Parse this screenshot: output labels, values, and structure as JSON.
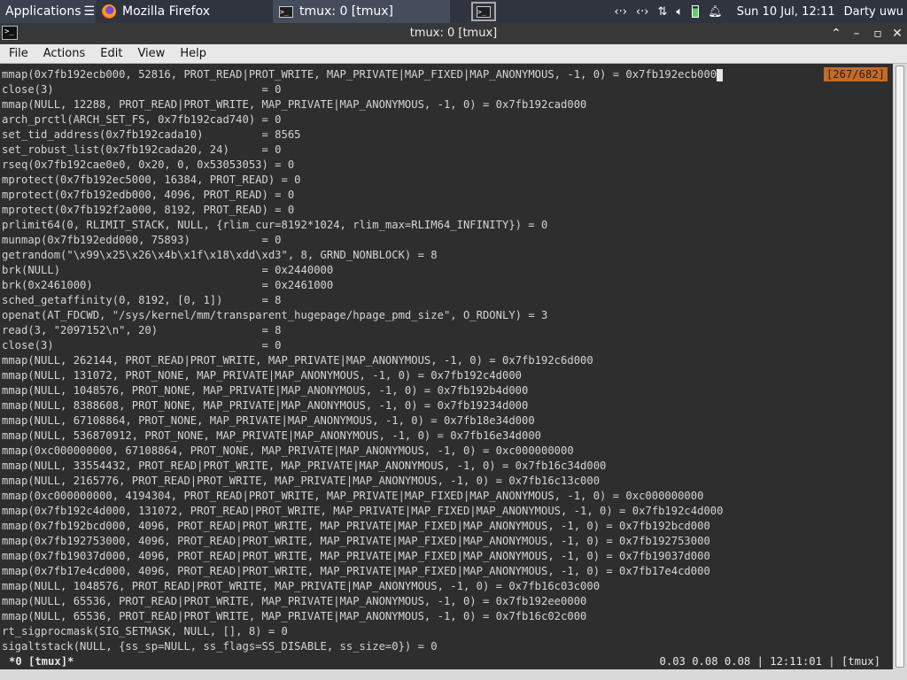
{
  "panel": {
    "app_menu": "Applications",
    "tasks": [
      {
        "label": "Mozilla Firefox",
        "icon": "firefox-icon"
      },
      {
        "label": "tmux: 0 [tmux]",
        "icon": "terminal-icon"
      }
    ],
    "clock": "Sun 10 Jul, 12:11",
    "user": "Darty uwu"
  },
  "window": {
    "title": "tmux: 0 [tmux]"
  },
  "menu": [
    "File",
    "Actions",
    "Edit",
    "View",
    "Help"
  ],
  "terminal": {
    "position_indicator": "[267/682]",
    "lines": [
      "mmap(0x7fb192ecb000, 52816, PROT_READ|PROT_WRITE, MAP_PRIVATE|MAP_FIXED|MAP_ANONYMOUS, -1, 0) = 0x7fb192ecb000",
      "close(3)                                = 0",
      "mmap(NULL, 12288, PROT_READ|PROT_WRITE, MAP_PRIVATE|MAP_ANONYMOUS, -1, 0) = 0x7fb192cad000",
      "arch_prctl(ARCH_SET_FS, 0x7fb192cad740) = 0",
      "set_tid_address(0x7fb192cada10)         = 8565",
      "set_robust_list(0x7fb192cada20, 24)     = 0",
      "rseq(0x7fb192cae0e0, 0x20, 0, 0x53053053) = 0",
      "mprotect(0x7fb192ec5000, 16384, PROT_READ) = 0",
      "mprotect(0x7fb192edb000, 4096, PROT_READ) = 0",
      "mprotect(0x7fb192f2a000, 8192, PROT_READ) = 0",
      "prlimit64(0, RLIMIT_STACK, NULL, {rlim_cur=8192*1024, rlim_max=RLIM64_INFINITY}) = 0",
      "munmap(0x7fb192edd000, 75893)           = 0",
      "getrandom(\"\\x99\\x25\\x26\\x4b\\x1f\\x18\\xdd\\xd3\", 8, GRND_NONBLOCK) = 8",
      "brk(NULL)                               = 0x2440000",
      "brk(0x2461000)                          = 0x2461000",
      "sched_getaffinity(0, 8192, [0, 1])      = 8",
      "openat(AT_FDCWD, \"/sys/kernel/mm/transparent_hugepage/hpage_pmd_size\", O_RDONLY) = 3",
      "read(3, \"2097152\\n\", 20)                = 8",
      "close(3)                                = 0",
      "mmap(NULL, 262144, PROT_READ|PROT_WRITE, MAP_PRIVATE|MAP_ANONYMOUS, -1, 0) = 0x7fb192c6d000",
      "mmap(NULL, 131072, PROT_NONE, MAP_PRIVATE|MAP_ANONYMOUS, -1, 0) = 0x7fb192c4d000",
      "mmap(NULL, 1048576, PROT_NONE, MAP_PRIVATE|MAP_ANONYMOUS, -1, 0) = 0x7fb192b4d000",
      "mmap(NULL, 8388608, PROT_NONE, MAP_PRIVATE|MAP_ANONYMOUS, -1, 0) = 0x7fb19234d000",
      "mmap(NULL, 67108864, PROT_NONE, MAP_PRIVATE|MAP_ANONYMOUS, -1, 0) = 0x7fb18e34d000",
      "mmap(NULL, 536870912, PROT_NONE, MAP_PRIVATE|MAP_ANONYMOUS, -1, 0) = 0x7fb16e34d000",
      "mmap(0xc000000000, 67108864, PROT_NONE, MAP_PRIVATE|MAP_ANONYMOUS, -1, 0) = 0xc000000000",
      "mmap(NULL, 33554432, PROT_READ|PROT_WRITE, MAP_PRIVATE|MAP_ANONYMOUS, -1, 0) = 0x7fb16c34d000",
      "mmap(NULL, 2165776, PROT_READ|PROT_WRITE, MAP_PRIVATE|MAP_ANONYMOUS, -1, 0) = 0x7fb16c13c000",
      "mmap(0xc000000000, 4194304, PROT_READ|PROT_WRITE, MAP_PRIVATE|MAP_FIXED|MAP_ANONYMOUS, -1, 0) = 0xc000000000",
      "mmap(0x7fb192c4d000, 131072, PROT_READ|PROT_WRITE, MAP_PRIVATE|MAP_FIXED|MAP_ANONYMOUS, -1, 0) = 0x7fb192c4d000",
      "mmap(0x7fb192bcd000, 4096, PROT_READ|PROT_WRITE, MAP_PRIVATE|MAP_FIXED|MAP_ANONYMOUS, -1, 0) = 0x7fb192bcd000",
      "mmap(0x7fb192753000, 4096, PROT_READ|PROT_WRITE, MAP_PRIVATE|MAP_FIXED|MAP_ANONYMOUS, -1, 0) = 0x7fb192753000",
      "mmap(0x7fb19037d000, 4096, PROT_READ|PROT_WRITE, MAP_PRIVATE|MAP_FIXED|MAP_ANONYMOUS, -1, 0) = 0x7fb19037d000",
      "mmap(0x7fb17e4cd000, 4096, PROT_READ|PROT_WRITE, MAP_PRIVATE|MAP_FIXED|MAP_ANONYMOUS, -1, 0) = 0x7fb17e4cd000",
      "mmap(NULL, 1048576, PROT_READ|PROT_WRITE, MAP_PRIVATE|MAP_ANONYMOUS, -1, 0) = 0x7fb16c03c000",
      "mmap(NULL, 65536, PROT_READ|PROT_WRITE, MAP_PRIVATE|MAP_ANONYMOUS, -1, 0) = 0x7fb192ee0000",
      "mmap(NULL, 65536, PROT_READ|PROT_WRITE, MAP_PRIVATE|MAP_ANONYMOUS, -1, 0) = 0x7fb16c02c000",
      "rt_sigprocmask(SIG_SETMASK, NULL, [], 8) = 0",
      "sigaltstack(NULL, {ss_sp=NULL, ss_flags=SS_DISABLE, ss_size=0}) = 0"
    ]
  },
  "status": {
    "window": "*0 [tmux]*",
    "right": "0.03 0.08 0.08 | 12:11:01 | [tmux]"
  }
}
